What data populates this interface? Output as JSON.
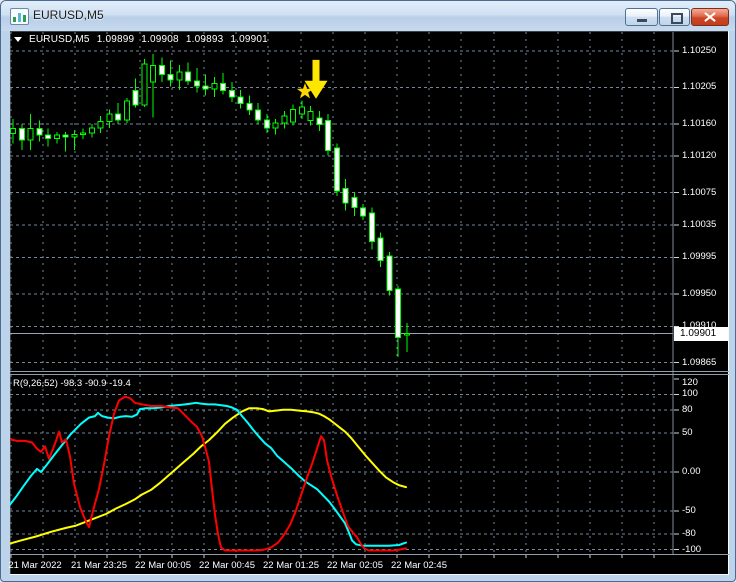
{
  "window": {
    "title": "EURUSD,M5"
  },
  "icons": {
    "app": "chart-window-icon",
    "minimize": "minimize-icon",
    "restore": "restore-down-icon",
    "close": "close-icon",
    "collapse": "triangle-down-icon",
    "signal_star": "star-icon",
    "signal_arrow": "down-arrow-icon"
  },
  "header": {
    "symbol": "EURUSD,M5",
    "open": "1.09899",
    "high": "1.09908",
    "low": "1.09893",
    "close": "1.09901"
  },
  "current_price": "1.09901",
  "indicator_label": "R(9,26,52) -98.3 -90.9 -19.4",
  "chart_data": {
    "type": "candlestick",
    "title": "EURUSD,M5",
    "symbol": "EURUSD",
    "timeframe": "M5",
    "last_bar": {
      "open": 1.09899,
      "high": 1.09908,
      "low": 1.09893,
      "close": 1.09901
    },
    "price_axis": {
      "labels": [
        "1.10250",
        "1.10205",
        "1.10160",
        "1.10120",
        "1.10075",
        "1.10035",
        "1.09995",
        "1.09950",
        "1.09910",
        "1.09865"
      ],
      "current": 1.09901,
      "range_top": 1.1025,
      "range_bottom": 1.09865
    },
    "time_axis": {
      "labels": [
        {
          "text": "21 Mar 2022",
          "x": 34
        },
        {
          "text": "21 Mar 23:25",
          "x": 98
        },
        {
          "text": "22 Mar 00:05",
          "x": 162
        },
        {
          "text": "22 Mar 00:45",
          "x": 226
        },
        {
          "text": "22 Mar 01:25",
          "x": 290
        },
        {
          "text": "22 Mar 02:05",
          "x": 354
        },
        {
          "text": "22 Mar 02:45",
          "x": 418
        }
      ]
    },
    "candles": [
      [
        1.10148,
        1.10166,
        1.10136,
        1.10154
      ],
      [
        1.10154,
        1.1016,
        1.10128,
        1.1014
      ],
      [
        1.1014,
        1.10172,
        1.10128,
        1.10154
      ],
      [
        1.10154,
        1.10164,
        1.10138,
        1.10146
      ],
      [
        1.10146,
        1.10154,
        1.10132,
        1.10142
      ],
      [
        1.10142,
        1.1015,
        1.10136,
        1.10146
      ],
      [
        1.10146,
        1.1015,
        1.10126,
        1.10144
      ],
      [
        1.10144,
        1.10152,
        1.10128,
        1.10147
      ],
      [
        1.10147,
        1.10154,
        1.10141,
        1.10149
      ],
      [
        1.10149,
        1.1016,
        1.10143,
        1.10155
      ],
      [
        1.10155,
        1.1017,
        1.10149,
        1.10163
      ],
      [
        1.10163,
        1.10178,
        1.10155,
        1.10172
      ],
      [
        1.10172,
        1.10186,
        1.1016,
        1.10165
      ],
      [
        1.10165,
        1.10192,
        1.10161,
        1.10188
      ],
      [
        1.10201,
        1.10216,
        1.1018,
        1.10183
      ],
      [
        1.10183,
        1.1024,
        1.10181,
        1.10234
      ],
      [
        1.10212,
        1.10246,
        1.10168,
        1.10232
      ],
      [
        1.10232,
        1.10242,
        1.10212,
        1.10221
      ],
      [
        1.10221,
        1.10238,
        1.10206,
        1.10214
      ],
      [
        1.10214,
        1.10233,
        1.10202,
        1.10224
      ],
      [
        1.10224,
        1.10236,
        1.10208,
        1.10213
      ],
      [
        1.10213,
        1.10229,
        1.10199,
        1.10207
      ],
      [
        1.10207,
        1.10221,
        1.10195,
        1.10203
      ],
      [
        1.10203,
        1.10218,
        1.10193,
        1.1021
      ],
      [
        1.1021,
        1.10223,
        1.10196,
        1.10201
      ],
      [
        1.10201,
        1.10212,
        1.10187,
        1.10193
      ],
      [
        1.10193,
        1.10202,
        1.10179,
        1.10185
      ],
      [
        1.10185,
        1.10195,
        1.10171,
        1.10177
      ],
      [
        1.10177,
        1.10186,
        1.10159,
        1.10165
      ],
      [
        1.10165,
        1.10172,
        1.10149,
        1.10155
      ],
      [
        1.10155,
        1.10166,
        1.10147,
        1.10161
      ],
      [
        1.10161,
        1.10176,
        1.10154,
        1.1017
      ],
      [
        1.10162,
        1.10184,
        1.10158,
        1.10178
      ],
      [
        1.10172,
        1.10189,
        1.10166,
        1.10181
      ],
      [
        1.10164,
        1.10182,
        1.10158,
        1.10175
      ],
      [
        1.10167,
        1.10176,
        1.10151,
        1.10159
      ],
      [
        1.10164,
        1.10172,
        1.10121,
        1.10127
      ],
      [
        1.1013,
        1.10136,
        1.10071,
        1.10077
      ],
      [
        1.1008,
        1.10092,
        1.10053,
        1.10062
      ],
      [
        1.10069,
        1.10075,
        1.10046,
        1.10057
      ],
      [
        1.10056,
        1.10061,
        1.10041,
        1.10046
      ],
      [
        1.1005,
        1.10057,
        1.10005,
        1.10015
      ],
      [
        1.10019,
        1.10026,
        1.09983,
        1.09991
      ],
      [
        1.09997,
        1.10002,
        1.09948,
        1.09954
      ],
      [
        1.09956,
        1.0996,
        1.09872,
        1.09896
      ],
      [
        1.09899,
        1.09914,
        1.09878,
        1.09901
      ]
    ],
    "markers": {
      "star": {
        "x": 304,
        "price": 1.102
      },
      "arrow": {
        "x": 315,
        "price_top": 1.10239,
        "price_tip": 1.10191
      }
    },
    "indicator": {
      "name": "R(9,26,52)",
      "label": "R(9,26,52) -98.3 -90.9 -19.4",
      "current_values": [
        -98.3,
        -90.9,
        -19.4
      ],
      "range": [
        -120,
        120
      ],
      "levels": [
        {
          "text": "120",
          "value": 120,
          "grid": false
        },
        {
          "text": "100",
          "value": 100,
          "grid": true
        },
        {
          "text": "80",
          "value": 80,
          "grid": true
        },
        {
          "text": "50",
          "value": 50,
          "grid": true
        },
        {
          "text": "0.00",
          "value": 0,
          "grid": true
        },
        {
          "text": "-50",
          "value": -50,
          "grid": true
        },
        {
          "text": "-80",
          "value": -80,
          "grid": true
        },
        {
          "text": "-100",
          "value": -100,
          "grid": true
        }
      ],
      "series": {
        "red": [
          [
            9,
            42
          ],
          [
            16,
            40
          ],
          [
            24,
            40
          ],
          [
            31,
            38
          ],
          [
            36,
            30
          ],
          [
            40,
            26
          ],
          [
            44,
            33
          ],
          [
            48,
            17
          ],
          [
            52,
            30
          ],
          [
            55,
            40
          ],
          [
            58,
            52
          ],
          [
            61,
            38
          ],
          [
            65,
            42
          ],
          [
            69,
            20
          ],
          [
            73,
            -15
          ],
          [
            79,
            -45
          ],
          [
            85,
            -64
          ],
          [
            88,
            -71
          ],
          [
            93,
            -45
          ],
          [
            98,
            -22
          ],
          [
            103,
            10
          ],
          [
            108,
            46
          ],
          [
            113,
            75
          ],
          [
            118,
            92
          ],
          [
            124,
            97
          ],
          [
            129,
            95
          ],
          [
            134,
            89
          ],
          [
            141,
            87
          ],
          [
            150,
            85
          ],
          [
            160,
            85
          ],
          [
            170,
            83
          ],
          [
            177,
            82
          ],
          [
            184,
            73
          ],
          [
            190,
            65
          ],
          [
            196,
            58
          ],
          [
            201,
            46
          ],
          [
            205,
            28
          ],
          [
            208,
            13
          ],
          [
            211,
            -22
          ],
          [
            214,
            -55
          ],
          [
            217,
            -80
          ],
          [
            220,
            -97
          ],
          [
            224,
            -101
          ],
          [
            240,
            -101
          ],
          [
            255,
            -101
          ],
          [
            263,
            -100
          ],
          [
            270,
            -97
          ],
          [
            277,
            -91
          ],
          [
            283,
            -81
          ],
          [
            289,
            -68
          ],
          [
            294,
            -53
          ],
          [
            300,
            -30
          ],
          [
            306,
            -7
          ],
          [
            311,
            10
          ],
          [
            316,
            30
          ],
          [
            320,
            46
          ],
          [
            323,
            41
          ],
          [
            326,
            15
          ],
          [
            330,
            -5
          ],
          [
            336,
            -30
          ],
          [
            342,
            -52
          ],
          [
            347,
            -70
          ],
          [
            352,
            -78
          ],
          [
            356,
            -84
          ],
          [
            360,
            -93
          ],
          [
            364,
            -99
          ],
          [
            368,
            -101
          ],
          [
            380,
            -101
          ],
          [
            392,
            -101
          ],
          [
            398,
            -100
          ],
          [
            405,
            -98.3
          ]
        ],
        "cyan": [
          [
            9,
            -42
          ],
          [
            15,
            -32
          ],
          [
            22,
            -19
          ],
          [
            30,
            -5
          ],
          [
            36,
            4
          ],
          [
            40,
            0
          ],
          [
            45,
            8
          ],
          [
            52,
            20
          ],
          [
            60,
            33
          ],
          [
            70,
            49
          ],
          [
            80,
            62
          ],
          [
            88,
            70
          ],
          [
            94,
            72
          ],
          [
            97,
            76
          ],
          [
            101,
            72
          ],
          [
            107,
            70
          ],
          [
            113,
            69
          ],
          [
            119,
            71
          ],
          [
            125,
            72
          ],
          [
            131,
            71
          ],
          [
            136,
            74
          ],
          [
            139,
            81
          ],
          [
            144,
            82
          ],
          [
            152,
            82
          ],
          [
            160,
            83
          ],
          [
            168,
            85
          ],
          [
            176,
            86
          ],
          [
            184,
            87
          ],
          [
            190,
            88
          ],
          [
            195,
            89
          ],
          [
            200,
            88
          ],
          [
            207,
            87
          ],
          [
            214,
            87
          ],
          [
            220,
            86
          ],
          [
            226,
            85
          ],
          [
            231,
            83
          ],
          [
            236,
            80
          ],
          [
            241,
            72
          ],
          [
            247,
            63
          ],
          [
            253,
            53
          ],
          [
            259,
            44
          ],
          [
            264,
            37
          ],
          [
            270,
            31
          ],
          [
            276,
            21
          ],
          [
            283,
            13
          ],
          [
            290,
            5
          ],
          [
            297,
            -4
          ],
          [
            304,
            -12
          ],
          [
            310,
            -17
          ],
          [
            316,
            -22
          ],
          [
            322,
            -30
          ],
          [
            328,
            -38
          ],
          [
            334,
            -48
          ],
          [
            339,
            -57
          ],
          [
            344,
            -66
          ],
          [
            348,
            -78
          ],
          [
            351,
            -88
          ],
          [
            355,
            -93
          ],
          [
            362,
            -95
          ],
          [
            375,
            -95
          ],
          [
            388,
            -95
          ],
          [
            398,
            -94
          ],
          [
            405,
            -90.9
          ]
        ],
        "yellow": [
          [
            9,
            -92
          ],
          [
            20,
            -88
          ],
          [
            35,
            -83
          ],
          [
            50,
            -77
          ],
          [
            65,
            -72
          ],
          [
            75,
            -69
          ],
          [
            85,
            -64
          ],
          [
            95,
            -59
          ],
          [
            105,
            -54
          ],
          [
            115,
            -47
          ],
          [
            125,
            -41
          ],
          [
            134,
            -35
          ],
          [
            141,
            -29
          ],
          [
            150,
            -23
          ],
          [
            158,
            -15
          ],
          [
            166,
            -6
          ],
          [
            175,
            4
          ],
          [
            183,
            13
          ],
          [
            192,
            23
          ],
          [
            200,
            33
          ],
          [
            208,
            41
          ],
          [
            216,
            51
          ],
          [
            224,
            62
          ],
          [
            232,
            70
          ],
          [
            241,
            78
          ],
          [
            248,
            82
          ],
          [
            256,
            82
          ],
          [
            262,
            81
          ],
          [
            268,
            78
          ],
          [
            275,
            79
          ],
          [
            282,
            80
          ],
          [
            290,
            80
          ],
          [
            298,
            79
          ],
          [
            306,
            78
          ],
          [
            312,
            77
          ],
          [
            318,
            75
          ],
          [
            323,
            72
          ],
          [
            328,
            68
          ],
          [
            333,
            63
          ],
          [
            338,
            58
          ],
          [
            344,
            52
          ],
          [
            350,
            44
          ],
          [
            357,
            33
          ],
          [
            364,
            22
          ],
          [
            371,
            12
          ],
          [
            378,
            2
          ],
          [
            385,
            -7
          ],
          [
            392,
            -13
          ],
          [
            398,
            -17
          ],
          [
            405,
            -19.4
          ]
        ]
      }
    }
  },
  "colors": {
    "background": "#000000",
    "grid": "#75879B",
    "candle_outline": "#00FF00",
    "bull_fill": "#000000",
    "bear_fill": "#FFFFFF",
    "price_line": "#9AA5B1",
    "axis_text": "#FFFFFF",
    "price_box_bg": "#FFFFFF",
    "price_box_text": "#000000",
    "indicator_red": "#FF0000",
    "indicator_cyan": "#00FFFF",
    "indicator_yellow": "#FFFF00",
    "arrow": "#FFE600",
    "star": "#FFD700",
    "tick": "#CFD6DD"
  }
}
